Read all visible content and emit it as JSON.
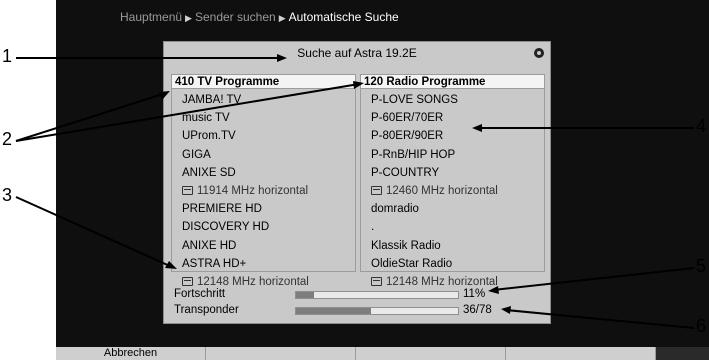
{
  "breadcrumb": {
    "item1": "Hauptmenü",
    "item2": "Sender suchen",
    "current": "Automatische Suche",
    "separator_icon": "triangle-right"
  },
  "dialog": {
    "title": "Suche auf Astra 19.2E",
    "status_icon": "satellite-icon"
  },
  "tv_column": {
    "header": "410 TV Programme",
    "items": [
      {
        "text": "JAMBA! TV",
        "type": "channel"
      },
      {
        "text": "music TV",
        "type": "channel"
      },
      {
        "text": "UProm.TV",
        "type": "channel"
      },
      {
        "text": "GIGA",
        "type": "channel"
      },
      {
        "text": "ANIXE SD",
        "type": "channel"
      },
      {
        "text": "11914 MHz horizontal",
        "type": "transponder"
      },
      {
        "text": "PREMIERE HD",
        "type": "channel"
      },
      {
        "text": "DISCOVERY HD",
        "type": "channel"
      },
      {
        "text": "ANIXE HD",
        "type": "channel"
      },
      {
        "text": "ASTRA HD+",
        "type": "channel"
      },
      {
        "text": "12148 MHz horizontal",
        "type": "transponder"
      }
    ]
  },
  "radio_column": {
    "header": "120 Radio Programme",
    "items": [
      {
        "text": "P-LOVE SONGS",
        "type": "channel"
      },
      {
        "text": "P-60ER/70ER",
        "type": "channel"
      },
      {
        "text": "P-80ER/90ER",
        "type": "channel"
      },
      {
        "text": "P-RnB/HIP HOP",
        "type": "channel"
      },
      {
        "text": "P-COUNTRY",
        "type": "channel"
      },
      {
        "text": "12460 MHz horizontal",
        "type": "transponder"
      },
      {
        "text": "domradio",
        "type": "channel"
      },
      {
        "text": ".",
        "type": "channel"
      },
      {
        "text": "Klassik Radio",
        "type": "channel"
      },
      {
        "text": "OldieStar Radio",
        "type": "channel"
      },
      {
        "text": "12148 MHz horizontal",
        "type": "transponder"
      }
    ]
  },
  "progress": {
    "label": "Fortschritt",
    "value_text": "11%",
    "fraction": 0.11
  },
  "transponder": {
    "label": "Transponder",
    "value_text": "36/78",
    "fraction": 0.46
  },
  "softkeys": {
    "cancel": "Abbrechen"
  },
  "callouts": [
    "1",
    "2",
    "3",
    "4",
    "5",
    "6"
  ],
  "colors": {
    "screen_bg": "#0f0f0f",
    "dialog_bg": "#c9c9c9",
    "bar_fill": "#7d7d7d"
  }
}
